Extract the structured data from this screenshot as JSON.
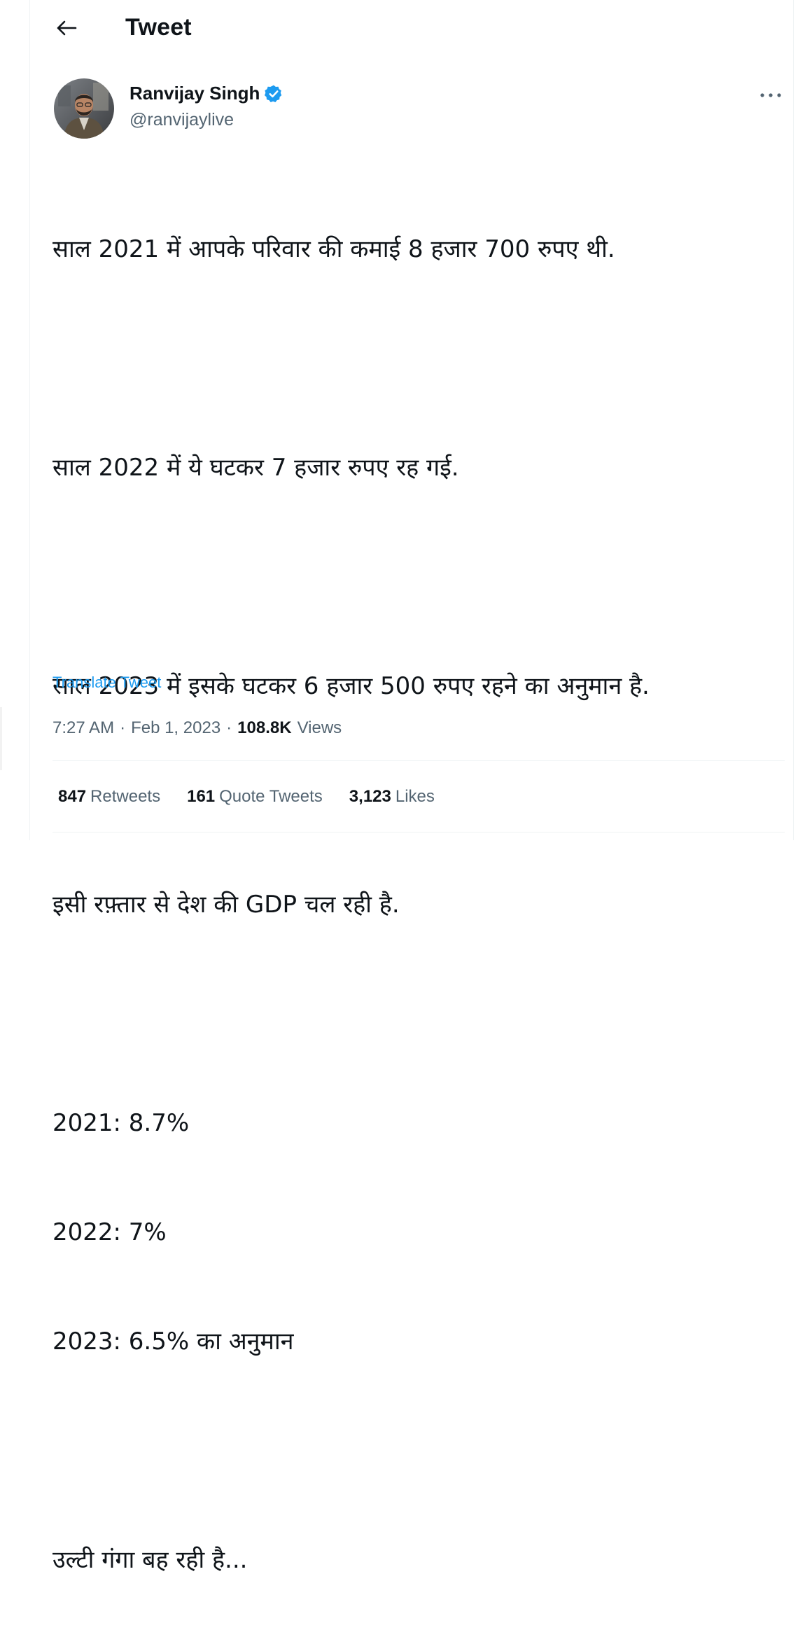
{
  "header": {
    "title": "Tweet",
    "back_icon": "arrow-left-icon"
  },
  "author": {
    "name": "Ranvijay Singh",
    "handle": "@ranvijaylive",
    "verified_icon": "verified-badge-icon",
    "verified_color": "#1d9bf0"
  },
  "more_icon": "more-horizontal-icon",
  "tweet": {
    "lines": [
      "साल 2021 में आपके परिवार की कमाई 8 हजार 700 रुपए थी.",
      "साल 2022 में ये घटकर 7 हजार रुपए रह गई.",
      "साल 2023 में इसके घटकर 6 हजार 500 रुपए रहने का अनुमान है.",
      "इसी रफ़्तार से देश की GDP चल रही है.",
      "2021: 8.7%",
      "2022: 7%",
      "2023: 6.5% का अनुमान",
      "उल्टी गंगा बह रही है..."
    ],
    "translate_label": "Translate Tweet"
  },
  "meta": {
    "time": "7:27 AM",
    "separator": "·",
    "date": "Feb 1, 2023",
    "views_count": "108.8K",
    "views_label": "Views"
  },
  "stats": {
    "retweets_count": "847",
    "retweets_label": "Retweets",
    "quotes_count": "161",
    "quotes_label": "Quote Tweets",
    "likes_count": "3,123",
    "likes_label": "Likes"
  },
  "colors": {
    "accent": "#1d9bf0",
    "text_primary": "#0f1419",
    "text_secondary": "#536471",
    "divider": "#eff3f4"
  }
}
